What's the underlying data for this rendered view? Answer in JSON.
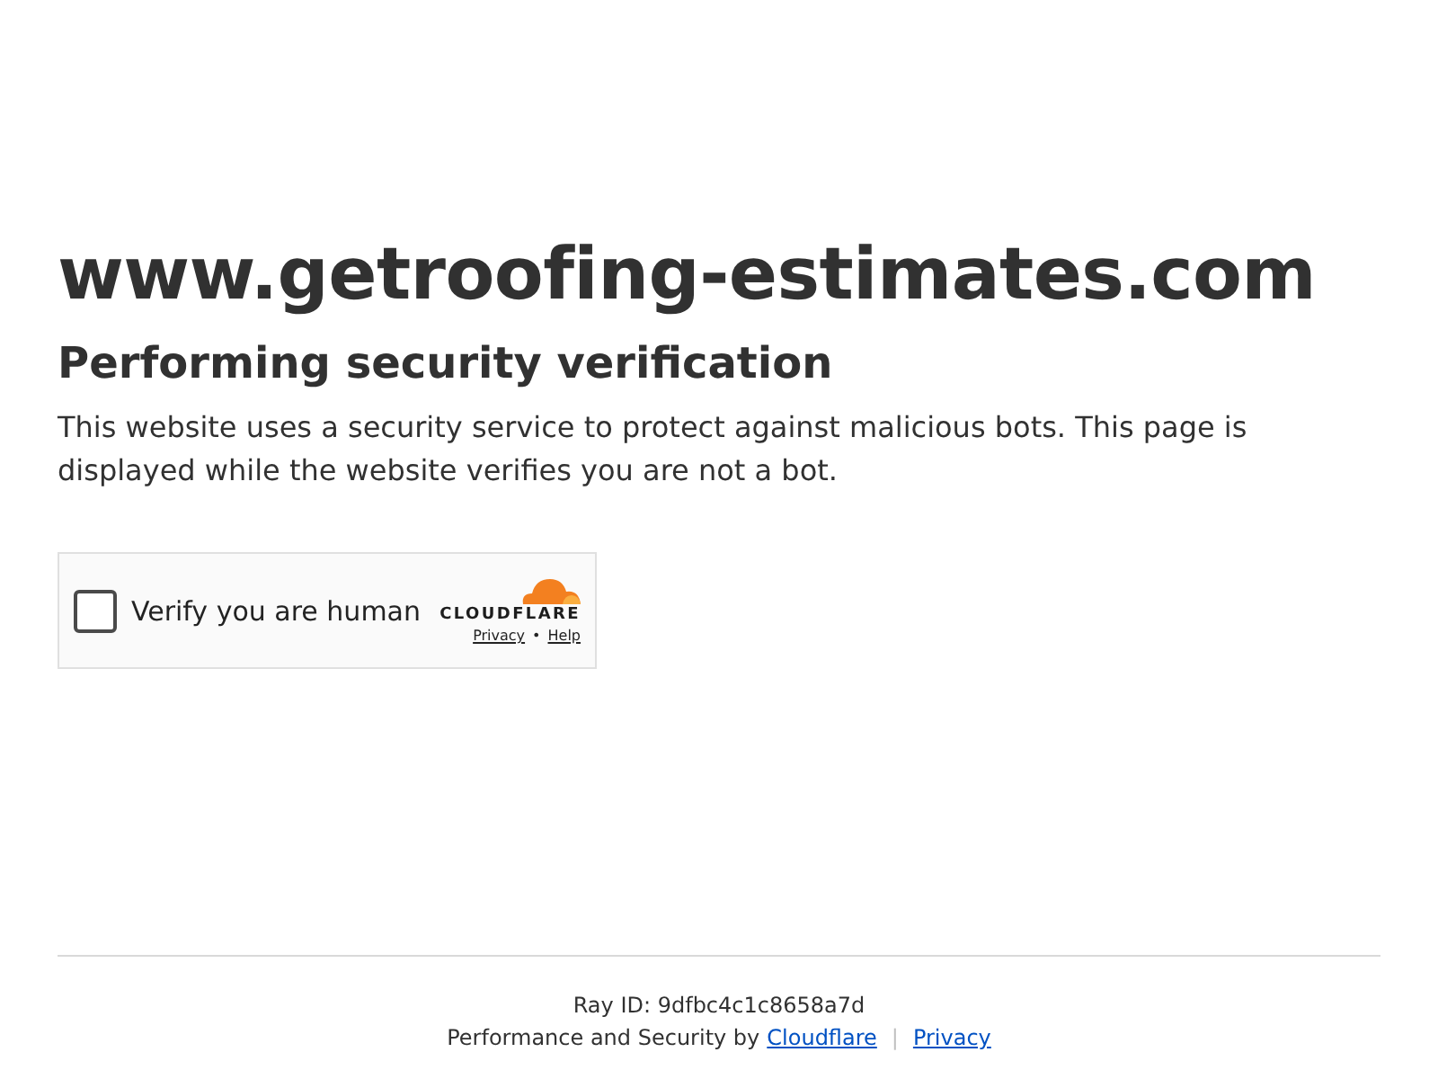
{
  "site": {
    "domain": "www.getroofing-estimates.com"
  },
  "heading": "Performing security verification",
  "description": "This website uses a security service to protect against malicious bots. This page is displayed while the website verifies you are not a bot.",
  "widget": {
    "label": "Verify you are human",
    "checked": false,
    "brand": "CLOUDFLARE",
    "links": [
      "Privacy",
      "Help"
    ],
    "link_separator": "•"
  },
  "footer": {
    "ray_id": "Ray ID: 9dfbc4c1c8658a7d",
    "credit": "Performance and Security by",
    "credit_link": "Cloudflare",
    "separator": "|",
    "privacy_link": "Privacy"
  }
}
